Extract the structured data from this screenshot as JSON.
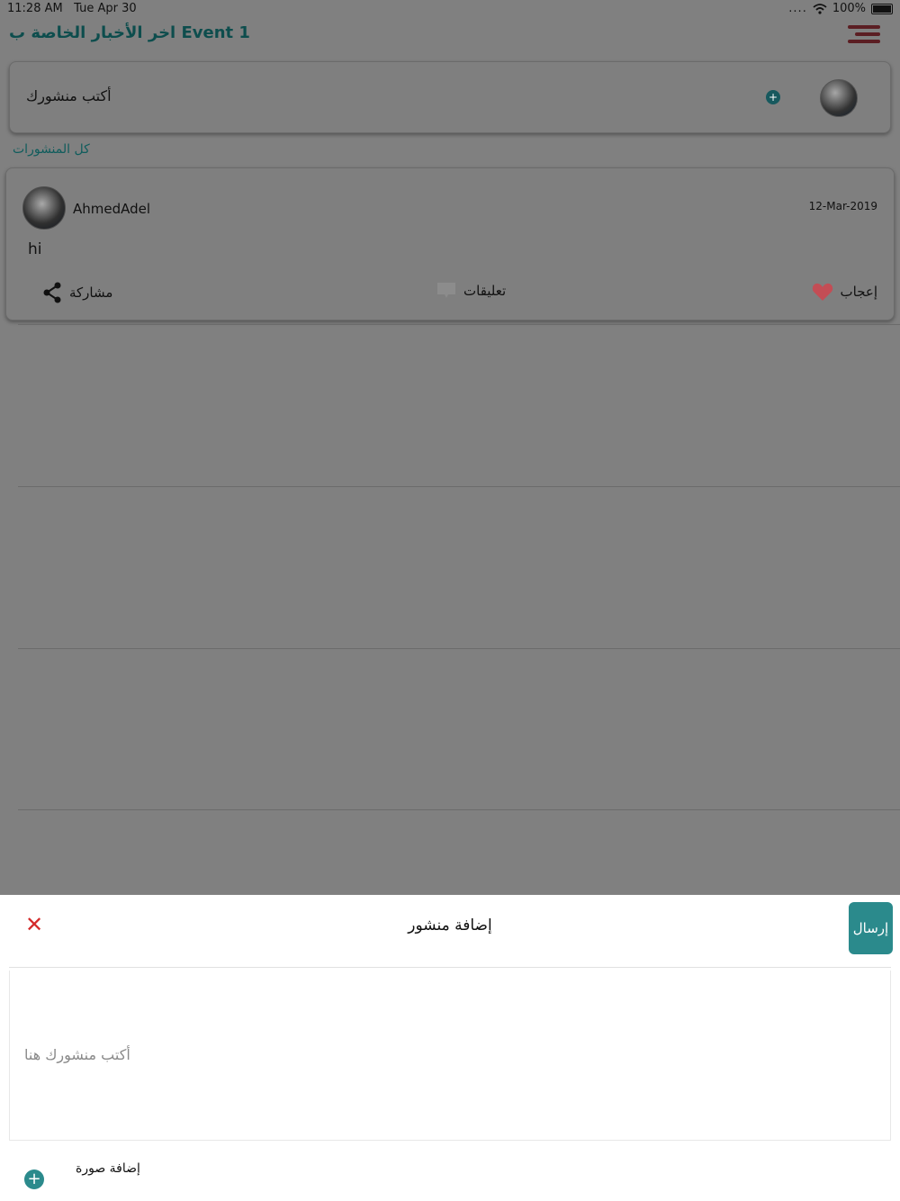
{
  "status": {
    "time": "11:28 AM",
    "date": "Tue Apr 30",
    "battery": "100%"
  },
  "header": {
    "title": "اخر الأخبار الخاصة ب Event 1"
  },
  "composer": {
    "placeholder": "أكتب منشورك"
  },
  "feed": {
    "section_label": "كل المنشورات",
    "posts": [
      {
        "author": "AhmedAdel",
        "date": "12-Mar-2019",
        "text": "hi",
        "like_label": "إعجاب",
        "comments_label": "تعليقات",
        "share_label": "مشاركة"
      }
    ]
  },
  "modal": {
    "title": "إضافة منشور",
    "send_label": "إرسال",
    "textarea_placeholder": "أكتب منشورك هنا",
    "add_image_label": "إضافة صورة"
  },
  "colors": {
    "accent": "#2b8a8c",
    "dark_teal": "#0d4d4d",
    "close_red": "#d42b2b",
    "heart": "#c34d55",
    "menu": "#5b1e23"
  },
  "icons": {
    "menu": "hamburger-icon",
    "add": "plus-circle-icon",
    "like": "heart-icon",
    "comment": "speech-bubble-icon",
    "share": "share-icon",
    "close": "close-icon",
    "wifi": "wifi-icon",
    "battery": "battery-icon"
  }
}
